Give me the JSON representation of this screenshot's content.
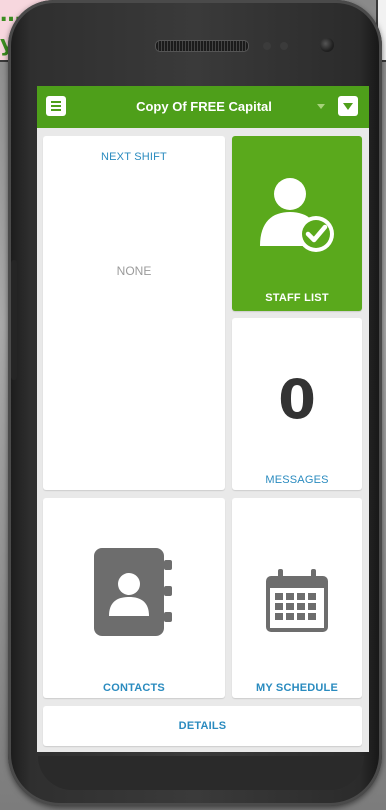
{
  "note": {
    "line1": "…",
    "line2": "y"
  },
  "app": {
    "title": "Copy Of FREE Capital",
    "accent_color": "#4e9f1a",
    "menu_icon": "hamburger-icon",
    "dropdown_icon": "chevron-down-icon"
  },
  "tiles": {
    "next_shift": {
      "label": "NEXT SHIFT",
      "value": "NONE"
    },
    "staff_list": {
      "label": "STAFF LIST",
      "icon": "user-check-icon"
    },
    "messages": {
      "label": "MESSAGES",
      "count": "0"
    },
    "contacts": {
      "label": "CONTACTS",
      "icon": "address-book-icon"
    },
    "my_schedule": {
      "label": "MY SCHEDULE",
      "icon": "calendar-icon"
    },
    "details": {
      "label": "DETAILS"
    }
  }
}
